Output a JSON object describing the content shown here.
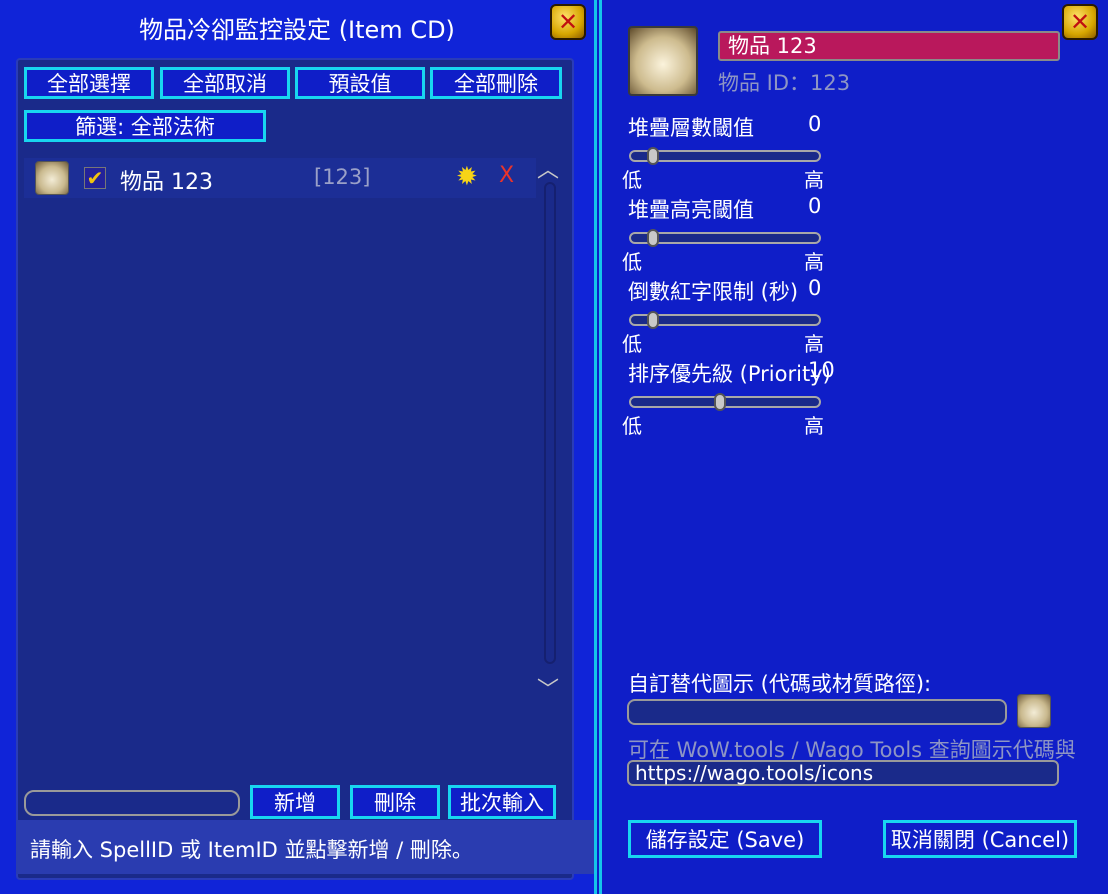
{
  "left": {
    "title": "物品冷卻監控設定 (Item CD)",
    "buttons": {
      "select_all": "全部選擇",
      "deselect_all": "全部取消",
      "default": "預設值",
      "delete_all": "全部刪除",
      "filter": "篩選: 全部法術"
    },
    "list": [
      {
        "name": "物品 123",
        "id": "[123]",
        "checked": "✔",
        "remove": "X"
      }
    ],
    "actions": {
      "add": "新增",
      "remove": "刪除",
      "batch": "批次輸入"
    },
    "hint": "請輸入 SpellID 或 ItemID 並點擊新增 / 刪除。"
  },
  "right": {
    "name_value": "物品 123",
    "item_id_label": "物品 ID：123",
    "sliders": [
      {
        "label": "堆疊層數閾值",
        "value": "0",
        "position": 0.1,
        "low": "低",
        "high": "高"
      },
      {
        "label": "堆疊高亮閾值",
        "value": "0",
        "position": 0.1,
        "low": "低",
        "high": "高"
      },
      {
        "label": "倒數紅字限制 (秒)",
        "value": "0",
        "position": 0.1,
        "low": "低",
        "high": "高"
      },
      {
        "label": "排序優先級 (Priority)",
        "value": "10",
        "position": 0.48,
        "low": "低",
        "high": "高"
      }
    ],
    "custom_icon_label": "自訂替代圖示 (代碼或材質路徑):",
    "wago_hint": "可在 WoW.tools / Wago Tools 查詢圖示代碼與",
    "url": "https://wago.tools/icons",
    "save": "儲存設定 (Save)",
    "cancel": "取消關閉 (Cancel)"
  },
  "colors": {
    "background": "#0f1ec8",
    "button_border": "#18d6f0",
    "name_field": "#b9185c",
    "close_icon": "#d7a600"
  }
}
